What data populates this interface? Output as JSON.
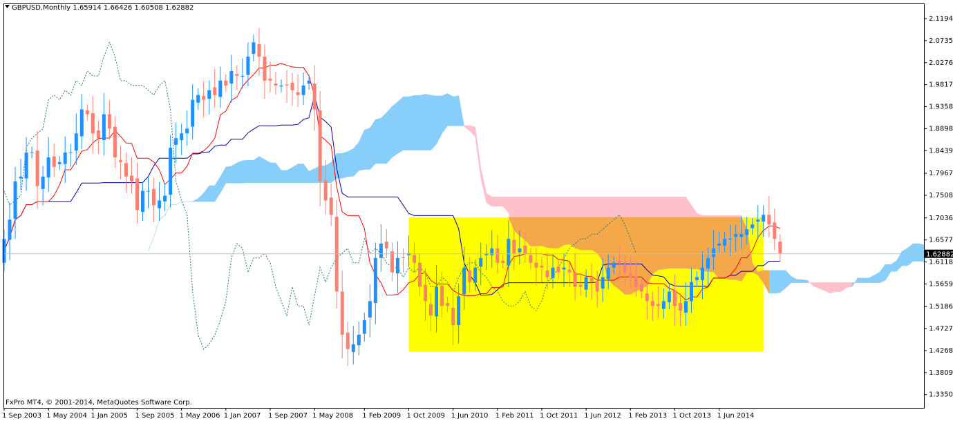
{
  "header": {
    "symbol_line": "GBPUSD,Monthly  1.65914 1.66426 1.60508 1.62882"
  },
  "footer": {
    "copyright": "FxPro MT4, © 2001-2014, MetaQuotes Software Corp."
  },
  "chart_data": {
    "type": "candlestick",
    "price_axis": {
      "ylim": [
        1.3505,
        2.1194
      ],
      "ticks": [
        "2.11940",
        "2.07350",
        "2.02760",
        "1.98170",
        "1.93580",
        "1.88985",
        "1.84395",
        "1.79675",
        "1.75085",
        "1.70360",
        "1.65770",
        "1.61180",
        "1.56590",
        "1.51865",
        "1.47275",
        "1.42685",
        "1.38095",
        "1.33505"
      ],
      "current_price_label": "1.62882"
    },
    "time_axis": {
      "labels": [
        "1 Sep 2003",
        "1 May 2004",
        "1 Jan 2005",
        "1 Sep 2005",
        "1 May 2006",
        "1 Jan 2007",
        "1 Sep 2007",
        "1 May 2008",
        "1 Feb 2009",
        "1 Oct 2009",
        "1 Jun 2010",
        "1 Feb 2011",
        "1 Oct 2011",
        "1 Jun 2012",
        "1 Feb 2013",
        "1 Oct 2013",
        "1 Jun 2014"
      ],
      "start": "2003-09",
      "end_extended": "2015-10"
    },
    "close_series": [
      1.66,
      1.7,
      1.78,
      1.79,
      1.84,
      1.84,
      1.77,
      1.79,
      1.83,
      1.81,
      1.82,
      1.84,
      1.84,
      1.88,
      1.93,
      1.92,
      1.88,
      1.87,
      1.92,
      1.89,
      1.83,
      1.82,
      1.79,
      1.78,
      1.72,
      1.76,
      1.76,
      1.73,
      1.74,
      1.75,
      1.85,
      1.87,
      1.88,
      1.89,
      1.95,
      1.96,
      1.95,
      1.97,
      1.96,
      1.99,
      1.98,
      2.01,
      2.0,
      2.0,
      2.04,
      2.07,
      2.04,
      1.99,
      1.99,
      1.98,
      1.98,
      1.98,
      1.97,
      1.96,
      1.98,
      1.99,
      1.93,
      1.78,
      1.74,
      1.71,
      1.55,
      1.46,
      1.43,
      1.44,
      1.46,
      1.49,
      1.53,
      1.62,
      1.65,
      1.64,
      1.59,
      1.62,
      1.62,
      1.63,
      1.61,
      1.56,
      1.53,
      1.5,
      1.56,
      1.52,
      1.52,
      1.48,
      1.54,
      1.6,
      1.57,
      1.6,
      1.62,
      1.63,
      1.64,
      1.61,
      1.61,
      1.66,
      1.63,
      1.64,
      1.63,
      1.61,
      1.6,
      1.6,
      1.58,
      1.6,
      1.59,
      1.6,
      1.59,
      1.56,
      1.56,
      1.58,
      1.57,
      1.55,
      1.58,
      1.6,
      1.61,
      1.61,
      1.59,
      1.58,
      1.56,
      1.55,
      1.53,
      1.52,
      1.52,
      1.53,
      1.55,
      1.52,
      1.51,
      1.53,
      1.57,
      1.58,
      1.6,
      1.62,
      1.64,
      1.65,
      1.66,
      1.66,
      1.67,
      1.67,
      1.68,
      1.69,
      1.7,
      1.71,
      1.69,
      1.66,
      1.63
    ],
    "ichimoku_lines": [
      "Tenkan-sen",
      "Kijun-sen",
      "Chikou Span",
      "Senkou Span A",
      "Senkou Span B"
    ],
    "colors": {
      "bull_candle": "#1e90ff",
      "bear_candle": "#fa8072",
      "tenkan": "#ff0000",
      "kijun": "#0000aa",
      "chikou": "#1e7a7a",
      "cloud_bull": "#87cefa",
      "cloud_bear": "#ffc0cb",
      "highlight_box": "#ffff00",
      "highlight_overlap": "#f5a849",
      "cloud_cross_green": "#7fc41e"
    },
    "highlight": {
      "from": "2009-10",
      "to": "2015-02",
      "price_low": 1.425,
      "price_high": 1.705
    },
    "grid": false
  }
}
